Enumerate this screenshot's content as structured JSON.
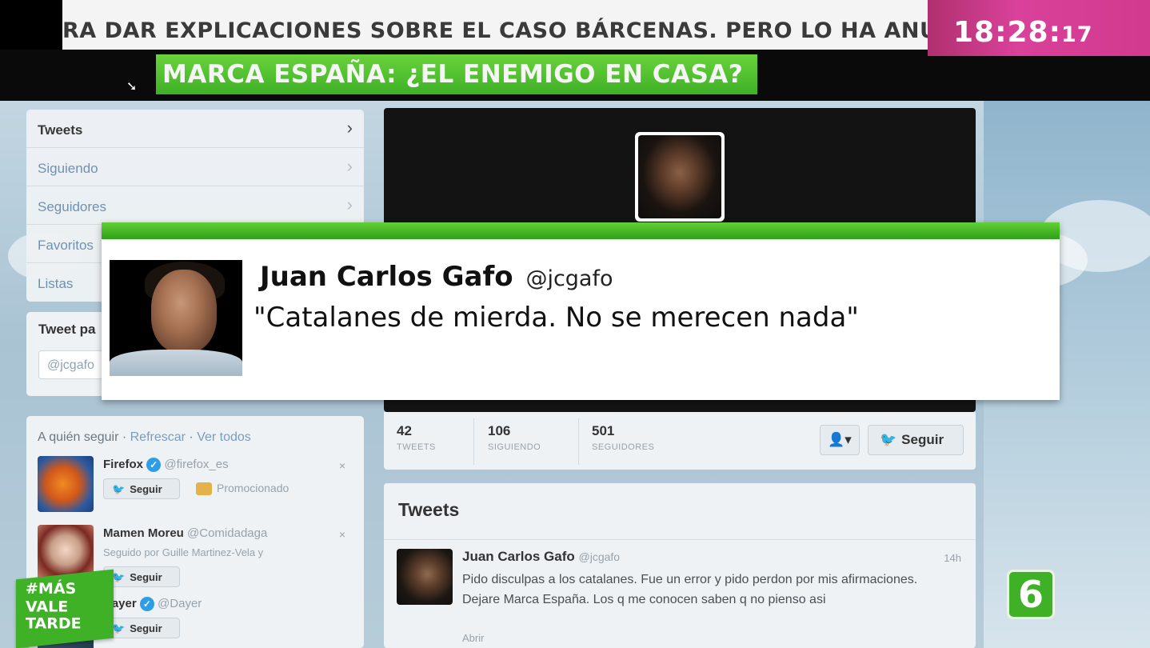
{
  "tv": {
    "ticker_text": "RA DAR EXPLICACIONES SOBRE EL CASO BÁRCENAS. PERO LO HA ANUNCIAD",
    "clock_main": "18:28:",
    "clock_seconds": "17",
    "headline": "MARCA ESPAÑA: ¿EL ENEMIGO EN CASA?",
    "hashtag_lines": [
      "#MÁS",
      "VALE",
      "TARDE"
    ],
    "channel_logo": "6",
    "colors": {
      "accent_green": "#3fb126",
      "clock_magenta": "#d9419a"
    }
  },
  "overlay_card": {
    "name": "Juan Carlos Gafo",
    "handle": "@jcgafo",
    "quote": "\"Catalanes de mierda. No se merecen nada\""
  },
  "sidebar": {
    "nav": [
      {
        "label": "Tweets"
      },
      {
        "label": "Siguiendo"
      },
      {
        "label": "Seguidores"
      },
      {
        "label": "Favoritos"
      },
      {
        "label": "Listas"
      }
    ],
    "compose_title": "Tweet pa",
    "compose_value": "@jcgafo",
    "who_to_follow": {
      "title": "A quién seguir",
      "refresh": "Refrescar",
      "view_all": "Ver todos",
      "items": [
        {
          "name": "Firefox",
          "handle": "@firefox_es",
          "follow": "Seguir",
          "promoted": "Promocionado"
        },
        {
          "name": "Mamen Moreu",
          "handle": "@Comidadaga",
          "sub": "Seguido por Guille Martinez-Vela y",
          "follow": "Seguir"
        },
        {
          "name": "Dayer",
          "handle": "@Dayer",
          "follow": "Seguir"
        }
      ]
    }
  },
  "profile": {
    "stats": [
      {
        "num": "42",
        "label": "TWEETS"
      },
      {
        "num": "106",
        "label": "SIGUIENDO"
      },
      {
        "num": "501",
        "label": "SEGUIDORES"
      }
    ],
    "follow_button": "Seguir"
  },
  "timeline": {
    "title": "Tweets",
    "tweet": {
      "name": "Juan Carlos Gafo",
      "handle": "@jcgafo",
      "time": "14h",
      "text": "Pido disculpas a los catalanes. Fue un error y pido perdon por mis afirmaciones. Dejare Marca España. Los q me conocen saben q no pienso asi",
      "footer": "Abrir"
    }
  }
}
